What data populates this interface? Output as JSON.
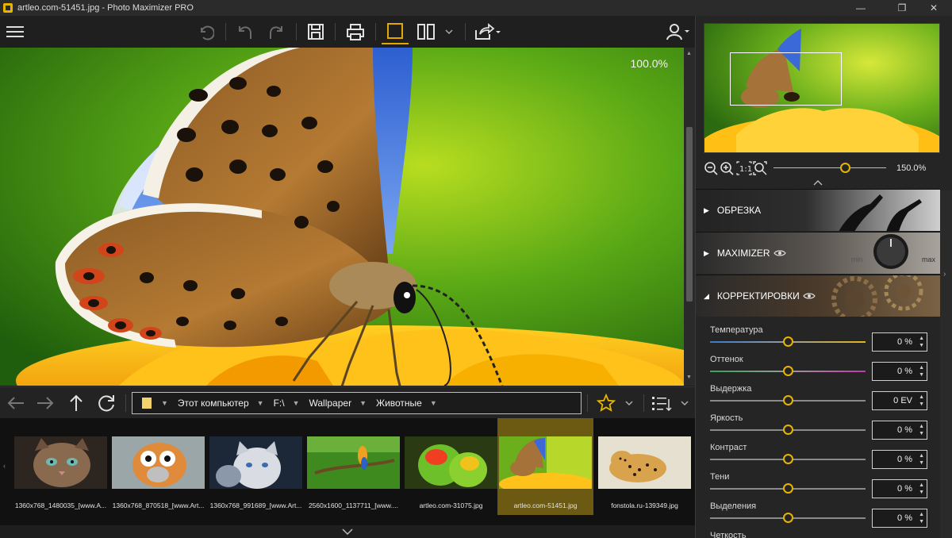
{
  "window": {
    "title": "artleo.com-51451.jpg - Photo Maximizer PRO",
    "minimize": "—",
    "maximize": "❐",
    "close": "✕"
  },
  "viewer": {
    "zoom_label": "100.0%"
  },
  "navbar": {
    "path": [
      "Этот компьютер",
      "F:\\",
      "Wallpaper",
      "Животные"
    ]
  },
  "filmstrip": {
    "items": [
      {
        "caption": "1360x768_1480035_[www.A...",
        "selected": false
      },
      {
        "caption": "1360x768_870518_[www.Art...",
        "selected": false
      },
      {
        "caption": "1360x768_991689_[www.Art...",
        "selected": false
      },
      {
        "caption": "2560x1600_1137711_[www....",
        "selected": false
      },
      {
        "caption": "artleo.com-31075.jpg",
        "selected": false
      },
      {
        "caption": "artleo.com-51451.jpg",
        "selected": true
      },
      {
        "caption": "fonstola.ru-139349.jpg",
        "selected": false
      }
    ]
  },
  "navigator": {
    "zoom_value": "150.0%"
  },
  "sections": [
    {
      "label": "ОБРЕЗКА",
      "arrow": "▶",
      "eye": false
    },
    {
      "label": "MAXIMIZER",
      "arrow": "▶",
      "eye": true,
      "min_label": "min",
      "max_label": "max"
    },
    {
      "label": "КОРРЕКТИРОВКИ",
      "arrow": "◢",
      "eye": true
    }
  ],
  "adjustments": [
    {
      "label": "Температура",
      "value": "0 %"
    },
    {
      "label": "Оттенок",
      "value": "0 %"
    },
    {
      "label": "Выдержка",
      "value": "0 EV"
    },
    {
      "label": "Яркость",
      "value": "0 %"
    },
    {
      "label": "Контраст",
      "value": "0 %"
    },
    {
      "label": "Тени",
      "value": "0 %"
    },
    {
      "label": "Выделения",
      "value": "0 %"
    },
    {
      "label": "Четкость",
      "value": ""
    }
  ],
  "colors": {
    "accent": "#e7b400",
    "background": "#1e1e1e"
  }
}
